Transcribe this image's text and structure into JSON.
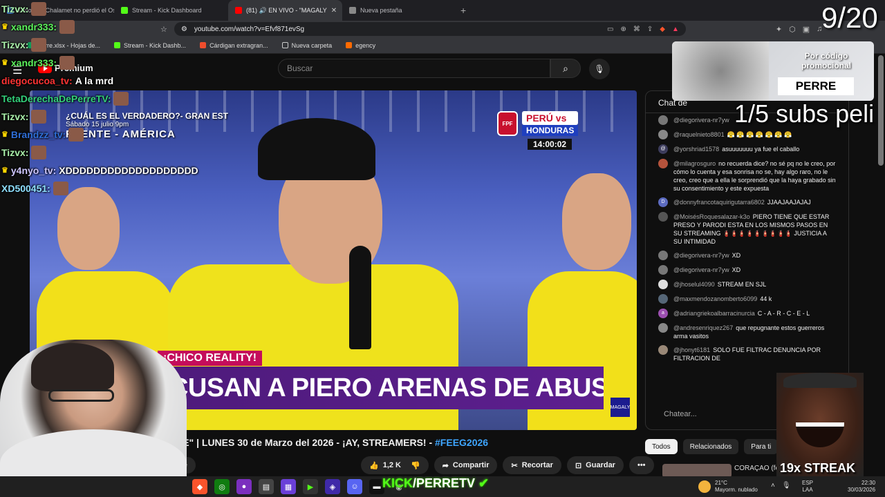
{
  "browser": {
    "tabs": [
      {
        "label": "Timothée Chalamet no perdió el Osc",
        "color": "#4a90e2"
      },
      {
        "label": "Stream - Kick Dashboard",
        "color": "#53fc18"
      },
      {
        "label": "(81) 🔊 EN VIVO - \"MAGALY",
        "color": "#ff0000"
      },
      {
        "label": "Nueva pestaña",
        "color": "#888888"
      }
    ],
    "new_tab": "+",
    "url": "youtube.com/watch?v=Efvf871evSg",
    "bookmarks": [
      {
        "label": "Perre.xlsx - Hojas de...",
        "color": "#0f9d58"
      },
      {
        "label": "Stream - Kick Dashb...",
        "color": "#53fc18"
      },
      {
        "label": "Cárdigan extragran...",
        "color": "#ee4d2d"
      },
      {
        "label": "Nueva carpeta",
        "color": "#cccccc"
      },
      {
        "label": "egency",
        "color": "#ff6a00"
      }
    ]
  },
  "youtube": {
    "logo": "Premium",
    "search_placeholder": "Buscar",
    "video": {
      "banner_line1": "¿CUÁL ES EL VERDADERO?- GRAN EST",
      "banner_line2": "Sábado 15 julio 9pm",
      "banner_line3": "FUENTE - AMÉRICA",
      "score_teams": "PERÚ vs",
      "score_team2": "HONDURAS",
      "score_time": "14:00:02",
      "chyron_tag": "¡CHICO REALITY!",
      "chyron": "ACUSAN A PIERO ARENAS DE ABUSO SEXUAL",
      "chyron_logo": "TV",
      "channel_bug": "MAGALY"
    },
    "title_main": "FIRME\" | LUNES 30 de Marzo del 2026 - ¡AY, STREAMERS! - ",
    "title_hashtag": "#FEEG2026",
    "subscribe_label": "me",
    "actions": {
      "like": "1,2 K",
      "share": "Compartir",
      "clip": "Recortar",
      "save": "Guardar",
      "more": "•••"
    },
    "chat": {
      "title": "Chat de",
      "input_placeholder": "Chatear...",
      "messages": [
        {
          "user": "@diegorivera-nr7yw",
          "text": "",
          "color": "#777777",
          "initial": ""
        },
        {
          "user": "@raquelnieto8801",
          "text": "😤 😤 😤 😤 😤 😤 😤",
          "color": "#888888",
          "initial": ""
        },
        {
          "user": "@yorshriad1578",
          "text": "asuuuuuuu ya fue el caballo",
          "color": "#3c3c5c",
          "initial": "@"
        },
        {
          "user": "@milagrosguro",
          "text": "no recuerda dice? no sé pq no le creo, por cómo lo cuenta y esa sonrisa no se, hay algo raro, no le creo, creo que a ella le sorprendió que la haya grabado sin su consentimiento y este expuesta",
          "color": "#b5533c",
          "initial": ""
        },
        {
          "user": "@donnyfrancotaquirigutarra6802",
          "text": "JJAAJAAJAJAJ",
          "color": "#5c6bc0",
          "initial": "D"
        },
        {
          "user": "@MoisésRoquesalazar-k3o",
          "text": "PIERO TIENE QUE ESTAR PRESO Y PARODI ESTA EN LOS MISMOS PASOS EN SU STREAMING 🧯🧯🧯🧯🧯🧯🧯🧯🧯 JUSTICIA A SU INTIMIDAD",
          "color": "#555555",
          "initial": ""
        },
        {
          "user": "@diegorivera-nr7yw",
          "text": "XD",
          "color": "#777777",
          "initial": ""
        },
        {
          "user": "@diegorivera-nr7yw",
          "text": "XD",
          "color": "#777777",
          "initial": ""
        },
        {
          "user": "@jhoselul4090",
          "text": "STREAM EN SJL",
          "color": "#dddddd",
          "initial": ""
        },
        {
          "user": "@maxmendozanomberto6099",
          "text": "44 k",
          "color": "#556677",
          "initial": ""
        },
        {
          "user": "@adriangriekoalbarracinurcia",
          "text": "C - A - R - C - E - L",
          "color": "#9c4fb0",
          "initial": "a"
        },
        {
          "user": "@andresenriquez267",
          "text": "que repugnante estos guerreros arma vasitos",
          "color": "#888888",
          "initial": ""
        },
        {
          "user": "@jhonyt6181",
          "text": "SOLO FUE FILTRAC DENUNCIA POR FILTRACION DE",
          "color": "#998877",
          "initial": ""
        }
      ]
    },
    "chips": [
      "Todos",
      "Relacionados",
      "Para ti"
    ],
    "related_title": "CORAÇAO (fea"
  },
  "overlay": {
    "counter": "9/20",
    "subs_goal": "1/5 subs peli",
    "promo_text": "Por código promocional",
    "promo_code": "PERRE",
    "streak": "19x STREAK",
    "kick_banner_prefix": "KICK",
    "kick_banner_name": "/PERRETV",
    "chat_lines": [
      {
        "name": "Tizvx:",
        "text": "",
        "color": "#aaf0aa",
        "crown": false
      },
      {
        "name": "xandr333:",
        "text": "",
        "color": "#5bf25b",
        "crown": true
      },
      {
        "name": "Tizvx:",
        "text": "",
        "color": "#aaf0aa",
        "crown": false
      },
      {
        "name": "xandr333:",
        "text": "",
        "color": "#5bf25b",
        "crown": true
      },
      {
        "name": "diegocucoa_tv:",
        "text": "A la mrd",
        "color": "#ff3333",
        "crown": false
      },
      {
        "name": "TetaDerechaDePerreTV:",
        "text": "",
        "color": "#33d17a",
        "crown": false
      },
      {
        "name": "Tizvx:",
        "text": "",
        "color": "#aaf0aa",
        "crown": false
      },
      {
        "name": "Brandzz_tv:",
        "text": "",
        "color": "#2f6fd8",
        "crown": true
      },
      {
        "name": "Tizvx:",
        "text": "",
        "color": "#aaf0aa",
        "crown": false
      },
      {
        "name": "y4nyo_tv:",
        "text": "XDDDDDDDDDDDDDDDDDDD",
        "color": "#cfc7ff",
        "crown": true
      },
      {
        "name": "XD500451:",
        "text": "",
        "color": "#8fe0ff",
        "crown": false
      }
    ]
  },
  "taskbar": {
    "weather_temp": "21°C",
    "weather_desc": "Mayorm. nublado",
    "lang1": "ESP",
    "lang2": "LAA",
    "time": "22:30",
    "date": "30/03/2026"
  }
}
